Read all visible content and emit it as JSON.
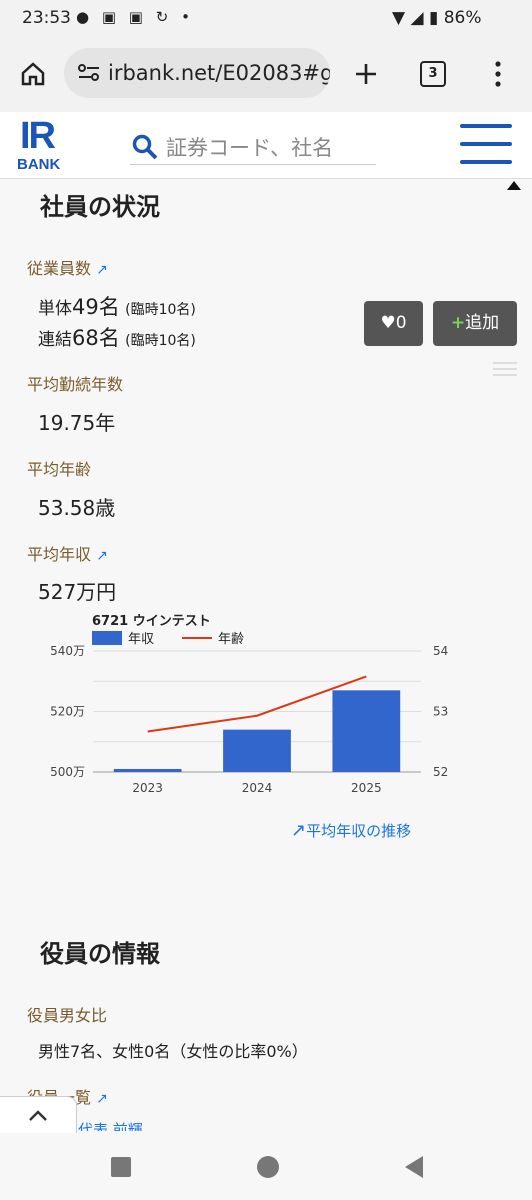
{
  "status": {
    "time": "23:53",
    "battery": "86%"
  },
  "browser": {
    "url": "irbank.net/E02083#g",
    "tab_count": "3"
  },
  "site": {
    "logo_top": "IR",
    "logo_bottom": "BANK",
    "search_placeholder": "証券コード、社名"
  },
  "section_employees": {
    "title": "社員の状況",
    "employees_label": "従業員数",
    "single_prefix": "単体",
    "single_num": "49名",
    "single_temp": "(臨時10名)",
    "consol_prefix": "連結",
    "consol_num": "68名",
    "consol_temp": "(臨時10名)",
    "tenure_label": "平均勤続年数",
    "tenure_value": "19.75年",
    "age_label": "平均年齢",
    "age_value": "53.58歳",
    "salary_label": "平均年収",
    "salary_value": "527万円",
    "like_label": "0",
    "add_label": "追加",
    "trend_link": "平均年収の推移"
  },
  "section_officers": {
    "title": "役員の情報",
    "ratio_label": "役員男女比",
    "ratio_value": "男性7名、女性0名（女性の比率0%）",
    "list_label": "役員一覧",
    "partial_text": "代表 前輝"
  },
  "colors": {
    "bar": "#3366cc",
    "line": "#dc3912",
    "label": "#7a5c2e",
    "link": "#1a73e8"
  },
  "chart_data": {
    "type": "bar",
    "title": "6721 ウインテスト",
    "categories": [
      "2023",
      "2024",
      "2025"
    ],
    "series": [
      {
        "name": "年収",
        "type": "bar",
        "axis": "left",
        "values": [
          501,
          514,
          527
        ]
      },
      {
        "name": "年齢",
        "type": "line",
        "axis": "right",
        "values": [
          52.67,
          52.93,
          53.58
        ]
      }
    ],
    "ylim_left": [
      500,
      540
    ],
    "ylim_right": [
      52,
      54
    ],
    "yticks_left": [
      "500万",
      "520万",
      "540万"
    ],
    "yticks_right": [
      "52",
      "53",
      "54"
    ],
    "legend": "top-left"
  }
}
